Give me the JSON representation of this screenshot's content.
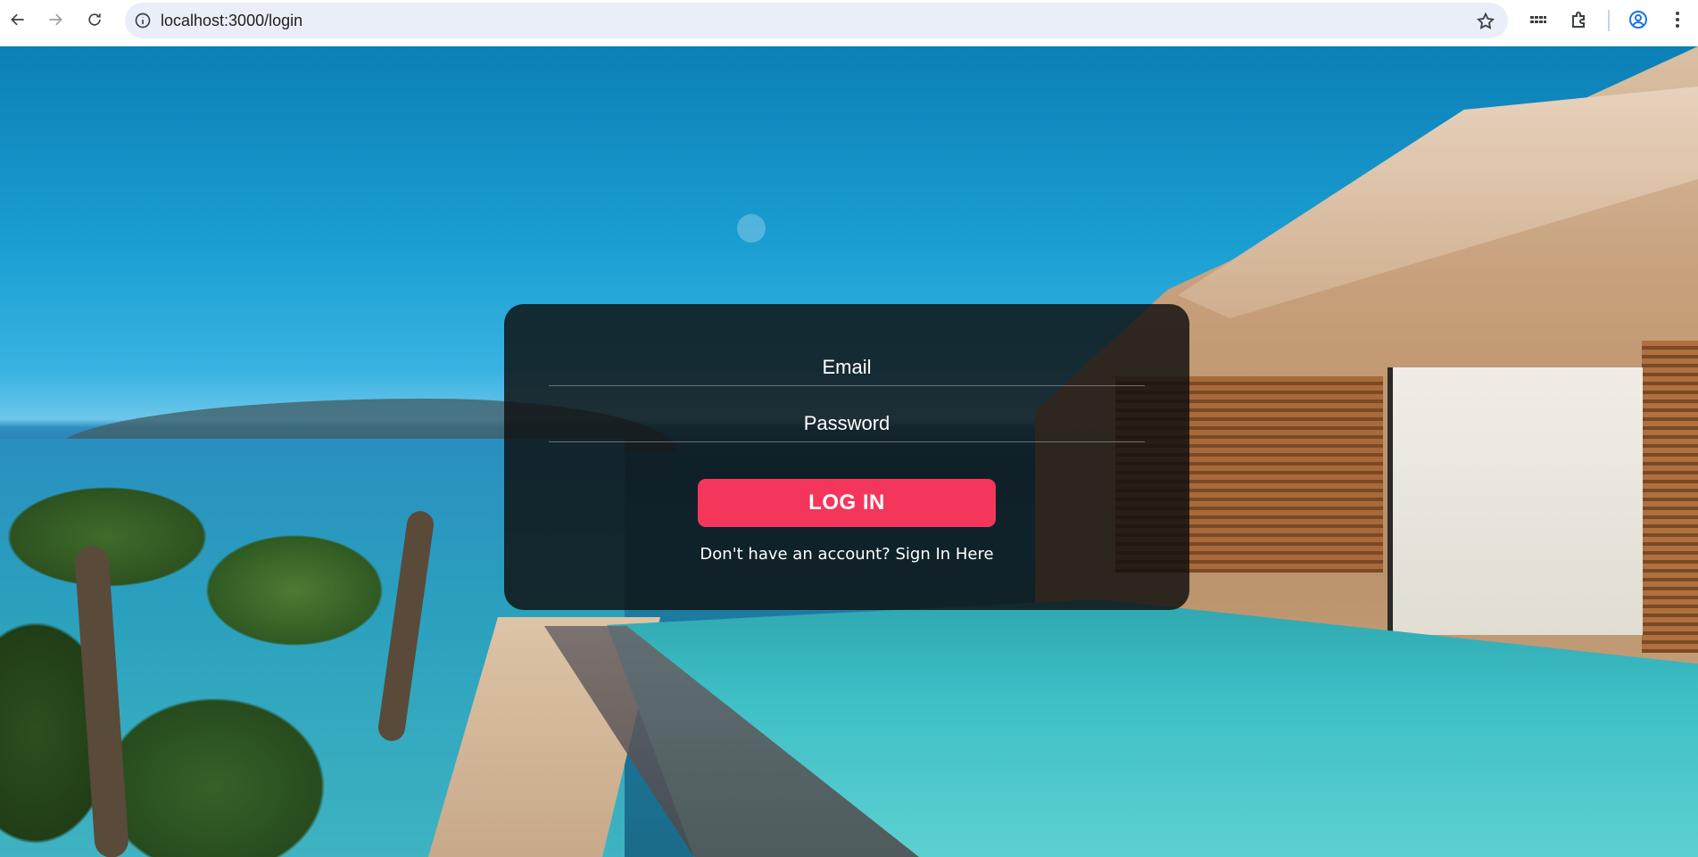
{
  "browser": {
    "url": "localhost:3000/login"
  },
  "login": {
    "email_placeholder": "Email",
    "password_placeholder": "Password",
    "button_label": "LOG IN",
    "signup_prompt": "Don't have an account?",
    "signup_link": "Sign In Here"
  },
  "colors": {
    "accent": "#f4365a",
    "card_background": "#0e0e0e"
  }
}
